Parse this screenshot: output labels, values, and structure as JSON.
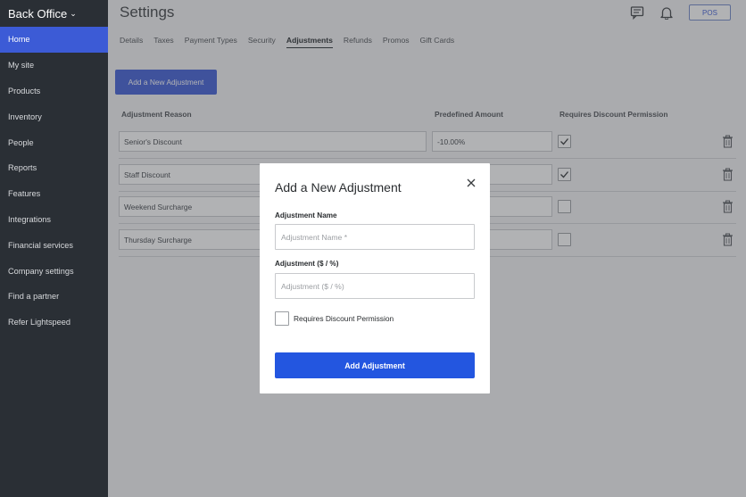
{
  "sidebar": {
    "brand": "Back Office",
    "items": [
      {
        "label": "Home",
        "active": true
      },
      {
        "label": "My site"
      },
      {
        "label": "Products"
      },
      {
        "label": "Inventory"
      },
      {
        "label": "People"
      },
      {
        "label": "Reports"
      },
      {
        "label": "Features"
      },
      {
        "label": "Integrations"
      },
      {
        "label": "Financial services"
      },
      {
        "label": "Company settings"
      },
      {
        "label": "Find a partner"
      },
      {
        "label": "Refer Lightspeed"
      }
    ]
  },
  "header": {
    "title": "Settings",
    "pos_label": "POS",
    "icons": [
      "chat-icon",
      "bell-icon"
    ]
  },
  "tabs": [
    "Details",
    "Taxes",
    "Payment Types",
    "Security",
    "Adjustments",
    "Refunds",
    "Promos",
    "Gift Cards"
  ],
  "active_tab": "Adjustments",
  "add_button_label": "Add a New Adjustment",
  "table": {
    "headers": [
      "Adjustment Reason",
      "Predefined Amount",
      "Requires Discount Permission"
    ],
    "rows": [
      {
        "reason": "Senior's Discount",
        "amount": "-10.00%",
        "requires_permission": true
      },
      {
        "reason": "Staff Discount",
        "amount": "",
        "requires_permission": true
      },
      {
        "reason": "Weekend Surcharge",
        "amount": "",
        "requires_permission": false
      },
      {
        "reason": "Thursday Surcharge",
        "amount": "",
        "requires_permission": false
      }
    ]
  },
  "modal": {
    "title": "Add a New Adjustment",
    "name_label": "Adjustment Name",
    "name_placeholder": "Adjustment Name *",
    "amount_label": "Adjustment ($ / %)",
    "amount_placeholder": "Adjustment ($ / %)",
    "checkbox_label": "Requires Discount Permission",
    "submit_label": "Add Adjustment"
  },
  "colors": {
    "sidebar_bg": "#2a2f35",
    "accent": "#3c5bd6",
    "submit": "#2356e0"
  }
}
